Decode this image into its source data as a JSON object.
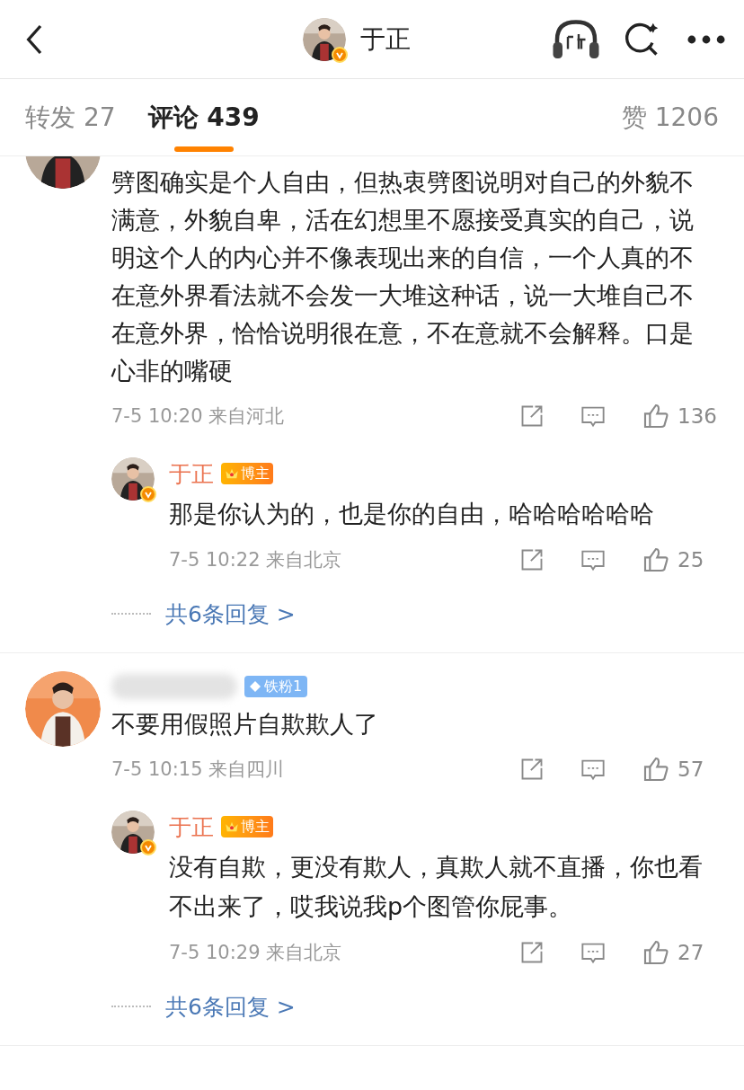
{
  "header": {
    "title": "于正",
    "verified": true
  },
  "tabs": [
    {
      "label": "转发 27",
      "selected": false
    },
    {
      "label": "评论 439",
      "selected": true
    },
    {
      "label": "赞 1206",
      "selected": false
    }
  ],
  "comments": [
    {
      "avatar_cut": true,
      "text": "劈图确实是个人自由，但热衷劈图说明对自己的外貌不满意，外貌自卑，活在幻想里不愿接受真实的自己，说明这个人的内心并不像表现出来的自信，一个人真的不在意外界看法就不会发一大堆这种话，说一大堆自己不在意外界，恰恰说明很在意，不在意就不会解释。口是心非的嘴硬",
      "time": "7-5 10:20 来自河北",
      "likes": "136",
      "reply": {
        "name": "于正",
        "badge": "博主",
        "verified": true,
        "text": "那是你认为的，也是你的自由，哈哈哈哈哈哈",
        "time": "7-5 10:22 来自北京",
        "likes": "25",
        "more": "共6条回复 >"
      }
    },
    {
      "name_hidden": true,
      "avatar_cut": false,
      "badge": "铁粉1",
      "text": "不要用假照片自欺欺人了",
      "time": "7-5 10:15 来自四川",
      "likes": "57",
      "reply": {
        "name": "于正",
        "badge": "博主",
        "verified": true,
        "text": "没有自欺，更没有欺人，真欺人就不直播，你也看不出来了，哎我说我p个图管你屁事。",
        "time": "7-5 10:29 来自北京",
        "likes": "27",
        "more": "共6条回复 >"
      }
    }
  ]
}
